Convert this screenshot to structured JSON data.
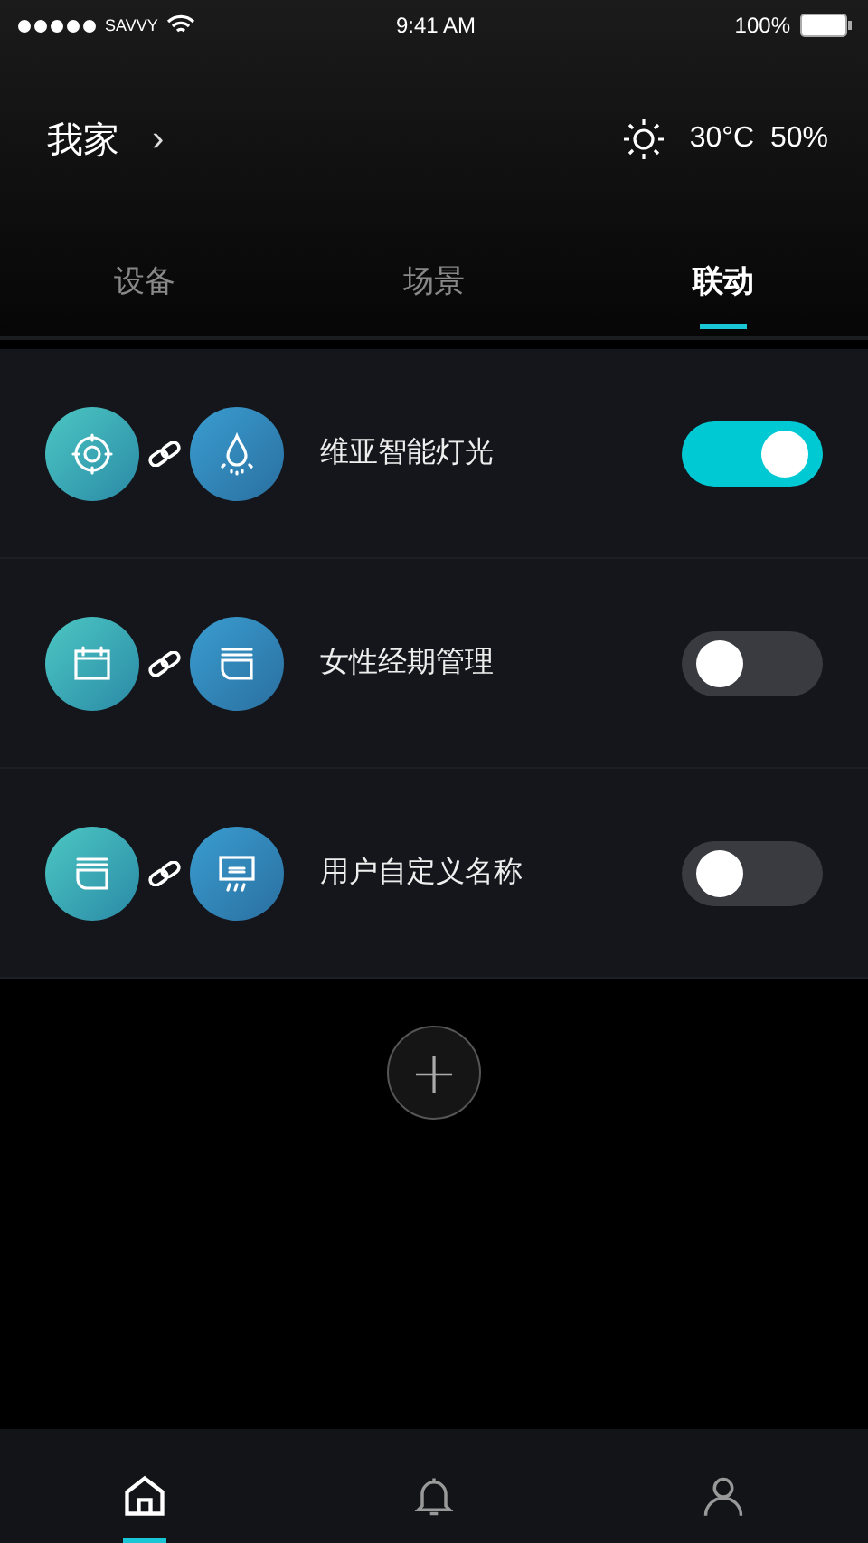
{
  "status_bar": {
    "carrier": "SAVVY",
    "time": "9:41 AM",
    "battery": "100%"
  },
  "header": {
    "home": "我家",
    "chevron": "›",
    "weather": "30°C  50%"
  },
  "tabs": [
    {
      "label": "设备",
      "selected": false
    },
    {
      "label": "场景",
      "selected": false
    },
    {
      "label": "联动",
      "selected": true
    }
  ],
  "links": [
    {
      "source": {
        "kind": "sensor"
      },
      "target": {
        "kind": "bulb"
      },
      "name": "维亚智能灯光",
      "on": true
    },
    {
      "source": {
        "kind": "calendar"
      },
      "target": {
        "kind": "bowl"
      },
      "name": "女性经期管理",
      "on": false
    },
    {
      "source": {
        "kind": "bowl"
      },
      "target": {
        "kind": "aircon"
      },
      "name": "用户自定义名称",
      "on": false
    }
  ],
  "add_button": {
    "label": "+"
  },
  "bottom_nav": [
    {
      "kind": "home",
      "selected": true
    },
    {
      "kind": "bell",
      "selected": false
    },
    {
      "kind": "person",
      "selected": false
    }
  ]
}
